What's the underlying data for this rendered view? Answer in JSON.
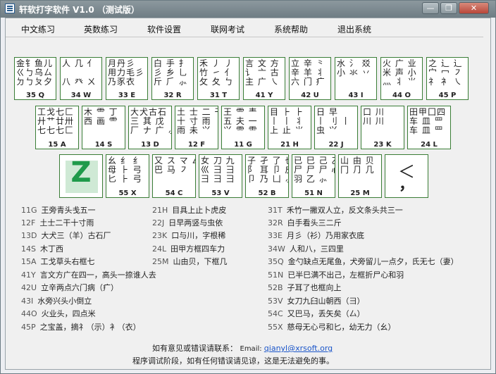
{
  "window": {
    "title": "轩软打字软件 V1.0 （测试版）",
    "min": "—",
    "max": "❐",
    "close": "✕"
  },
  "menu": [
    "中文练习",
    "英数练习",
    "软件设置",
    "联网考试",
    "系统帮助",
    "退出系统"
  ],
  "keys_row1": [
    {
      "glyph": "金钅鱼儿\nㄍㄅ乌ㄙ\nㄉㄅㄆ夕",
      "code": "35 Q"
    },
    {
      "glyph": "人 几 亻\n\n八 癶 ㄨ",
      "code": "34 W"
    },
    {
      "glyph": "月丹彡\n用力毛彡\n乃豕衣",
      "code": "33 E"
    },
    {
      "glyph": "白 手 扌\n彡 乡 乚\n斤 ⺁ ⺗",
      "code": "32 R"
    },
    {
      "glyph": "禾 丿 丿\n竹 ㇀ 亻\n攵 夂 ㄅ",
      "code": "31 T"
    },
    {
      "glyph": "言 文 方\n讠 亠 古\n主 广 ㇏",
      "code": "41 Y"
    },
    {
      "glyph": "立 辛 ⺀\n辛 羊 丬\n六 门 疒",
      "code": "42 U"
    },
    {
      "glyph": "水 氵 㸚\n小 氺 丷\n",
      "code": "43 I"
    },
    {
      "glyph": "火 广 业\n米 声 小\n灬 丬 ⺌",
      "code": "44 O"
    },
    {
      "glyph": "之 辶 辶\n宀 冖 ㇇\n礻 衤 ㇏",
      "code": "45 P"
    }
  ],
  "keys_row2": [
    {
      "glyph": "工戈七匚\n廾艹廿卅\n七七七匚",
      "code": "15 A"
    },
    {
      "glyph": "木 ⻗ 丁\n西 画 ⻗",
      "code": "14 S"
    },
    {
      "glyph": "大犬古石\n三 其 戊\n厂 ナ 广 ⺗",
      "code": "13 D"
    },
    {
      "glyph": "土 士 二 干\n十 寸 雨\n雨 未 ⺍",
      "code": "12 F"
    },
    {
      "glyph": "王 ⻗ 龶\n五 夫 一\n⺍ ⻗ ⻗",
      "code": "11 G"
    },
    {
      "glyph": "目 ⺊ ⺊\n丨 丨 丬\n上 止 ⺌",
      "code": "21 H"
    },
    {
      "glyph": "日 早\n丨 刂 丨\n虫 ⺍",
      "code": "22 J"
    },
    {
      "glyph": "口 川\n川 川",
      "code": "23 K"
    },
    {
      "glyph": "田甲囗四\n车 皿 罒\n车 皿 罒",
      "code": "24 L"
    }
  ],
  "keys_row3": [
    {
      "glyph": "幺 纟 纟\n母 ⺊ 弓\n匕 ⺊ 弓",
      "code": "55 X"
    },
    {
      "glyph": "又 ス マ 厶\n巴 马 ㇇",
      "code": "54 C"
    },
    {
      "glyph": "女 刀 九\n巛 彐 ⺕\n彐 ⺕ ⺕",
      "code": "53 V"
    },
    {
      "glyph": "子 孑 了 也\n阝 耳 卩 皮\n卩 乃 凵 ⺗",
      "code": "52 B"
    },
    {
      "glyph": "已 巳 己 乙\n尸 尸 尸 心\n羽 乙 ⺗",
      "code": "51 N"
    },
    {
      "glyph": "山 由 贝\n冂 ⺆ 几",
      "code": "25 M"
    }
  ],
  "big_key": "Z",
  "punct_key": {
    "top": "＜",
    "bottom": "，"
  },
  "ref_col1": [
    {
      "c": "11G",
      "t": "王旁青头戋五一"
    },
    {
      "c": "12F",
      "t": "土士二干十寸雨"
    },
    {
      "c": "13D",
      "t": "大犬三（羊）古石厂"
    },
    {
      "c": "14S",
      "t": "木丁西"
    },
    {
      "c": "15A",
      "t": "工戈草头右框七"
    },
    {
      "c": "41Y",
      "t": "言文方广在四一，高头一捺谁人去"
    },
    {
      "c": "42U",
      "t": "立辛两点六门病（疒）"
    },
    {
      "c": "43I",
      "t": "水旁兴头小倒立"
    },
    {
      "c": "44O",
      "t": "火业头，四点米"
    },
    {
      "c": "45P",
      "t": "之宝盖，摘礻（示）衤（衣）"
    }
  ],
  "ref_col2": [
    {
      "c": "21H",
      "t": "目具上止卜虎皮"
    },
    {
      "c": "22J",
      "t": "日早两竖与虫依"
    },
    {
      "c": "23K",
      "t": "口与川，字根稀"
    },
    {
      "c": "24L",
      "t": "田甲方框四车力"
    },
    {
      "c": "25M",
      "t": "山由贝，下框几"
    }
  ],
  "ref_col3": [
    {
      "c": "31T",
      "t": "禾竹一撇双人立，反文条头共三一"
    },
    {
      "c": "32R",
      "t": "白手看头三二斤"
    },
    {
      "c": "33E",
      "t": "月彡（衫）乃用家衣底"
    },
    {
      "c": "34W",
      "t": "人和八，三四里"
    },
    {
      "c": "35Q",
      "t": "金勺缺点无尾鱼，犬旁留儿一点夕，氏无七（妻）"
    },
    {
      "c": "51N",
      "t": "已半巳满不出己，左框折尸心和羽"
    },
    {
      "c": "52B",
      "t": "子耳了也框向上"
    },
    {
      "c": "53V",
      "t": "女刀九臼山朝西（彐）"
    },
    {
      "c": "54C",
      "t": "又巴马，丢矢矣（厶）"
    },
    {
      "c": "55X",
      "t": "慈母无心弓和匕，幼无力（幺）"
    }
  ],
  "footer": {
    "line1": "如有意见或错误请联系：",
    "email_label": "Email: ",
    "email": "qianyl@xrsoft.org",
    "line2": "程序调试阶段，如有任何错误请见谅，这是无法避免的事。"
  }
}
